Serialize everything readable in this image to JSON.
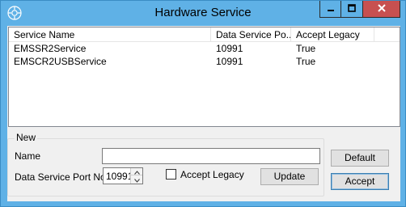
{
  "window": {
    "title": "Hardware Service",
    "icon": "service-icon",
    "controls": [
      "minimize-icon",
      "maximize-icon",
      "close-icon"
    ],
    "accent": "#5fb1e6",
    "close_color": "#c75050"
  },
  "list": {
    "columns": [
      "Service Name",
      "Data Service Po...",
      "Accept Legacy"
    ],
    "rows": [
      [
        "EMSSR2Service",
        "10991",
        "True"
      ],
      [
        "EMSCR2USBService",
        "10991",
        "True"
      ]
    ]
  },
  "group": {
    "label": "New",
    "name_label": "Name",
    "name_value": "",
    "port_label": "Data Service Port No.",
    "port_value": "10991",
    "legacy_label": "Accept Legacy",
    "legacy_checked": false,
    "update_label": "Update"
  },
  "actions": {
    "default_label": "Default",
    "accept_label": "Accept"
  }
}
